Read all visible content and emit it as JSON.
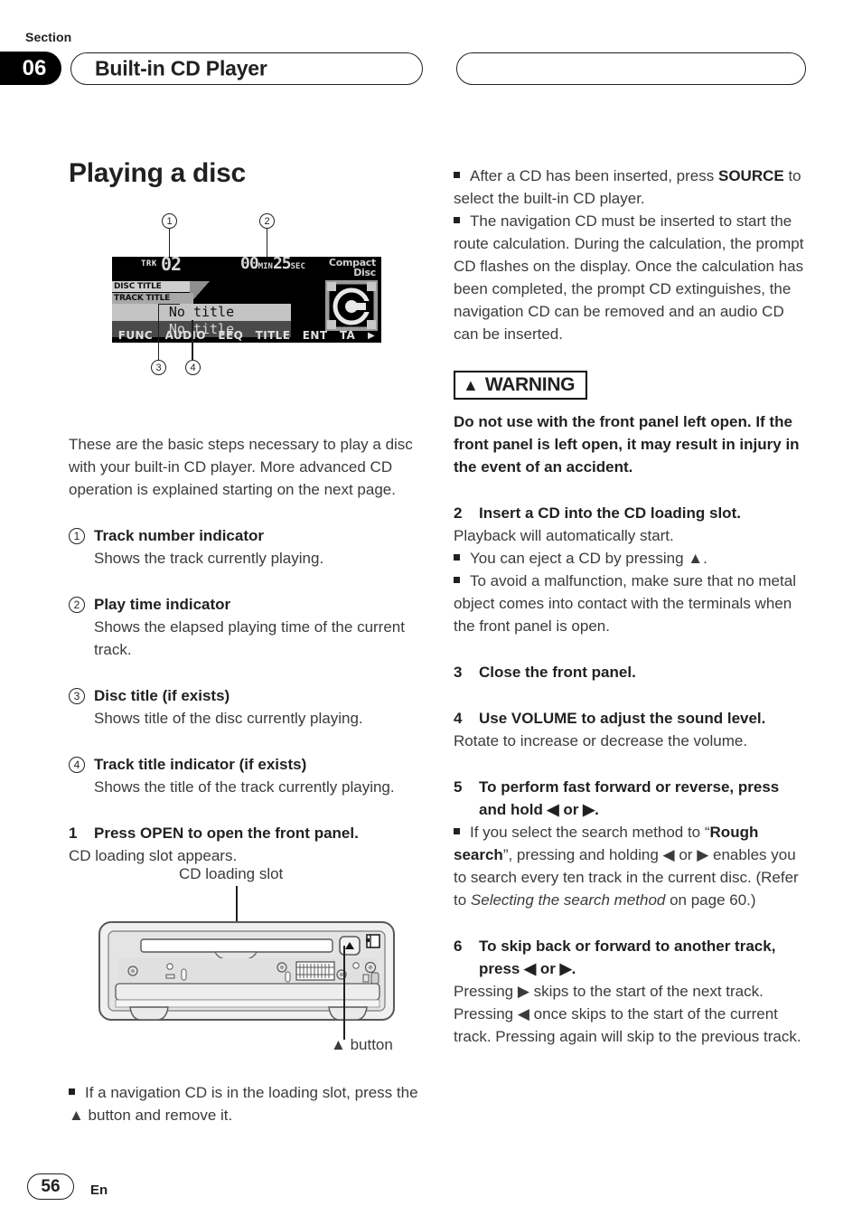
{
  "header": {
    "section_label": "Section",
    "section_number": "06",
    "title": "Built-in CD Player"
  },
  "left": {
    "page_title": "Playing a disc",
    "intro": "These are the basic steps necessary to play a disc with your built-in CD player. More advanced CD operation is explained starting on the next page.",
    "items": [
      {
        "num": "1",
        "title": "Track number indicator",
        "desc": "Shows the track currently playing."
      },
      {
        "num": "2",
        "title": "Play time indicator",
        "desc": "Shows the elapsed playing time of the current track."
      },
      {
        "num": "3",
        "title": "Disc title (if exists)",
        "desc": "Shows title of the disc currently playing."
      },
      {
        "num": "4",
        "title": "Track title indicator (if exists)",
        "desc": "Shows the title of the track currently playing."
      }
    ],
    "step1": {
      "num": "1",
      "title": "Press OPEN to open the front panel.",
      "body": "CD loading slot appears."
    },
    "figure": {
      "slot_label": "CD loading slot",
      "eject_label": "button",
      "eject_icon": "eject-icon"
    },
    "note": {
      "line1": "If a navigation CD is in the loading slot, press the ",
      "eject_icon": "▲",
      "line2": " button and remove it."
    }
  },
  "lcd": {
    "trk_label": "TRK",
    "track_number": "02",
    "time_min": "00",
    "min_label": "MIN",
    "time_sec": "25",
    "sec_label": "SEC",
    "logo_line1": "Compact",
    "logo_line2": "Disc",
    "disc_title_tag": "DISC TITLE",
    "track_title_tag": "TRACK TITLE",
    "disc_title_value": "No title",
    "track_title_value": "No title",
    "buttons": [
      "FUNC",
      "AUDIO",
      "EEQ",
      "TITLE",
      "ENT",
      "TA"
    ],
    "more_arrow": "▶",
    "callouts": [
      "1",
      "2",
      "3",
      "4"
    ]
  },
  "right": {
    "notes_top": [
      {
        "pre": "After a CD has been inserted, press ",
        "bold": "SOURCE",
        "post": " to select the built-in CD player."
      },
      {
        "pre": "The navigation CD must be inserted to start the route calculation. During the calculation, the prompt CD flashes on the display. Once the calculation has been completed, the prompt CD extinguishes, the navigation CD can be removed and an audio CD can be inserted.",
        "bold": "",
        "post": ""
      }
    ],
    "warning": {
      "label": "WARNING",
      "triangle": "⚠",
      "body": "Do not use with the front panel left open. If the front panel is left open, it may result in injury in the event of an accident."
    },
    "step2": {
      "num": "2",
      "title": "Insert a CD into the CD loading slot.",
      "body": "Playback will automatically start.",
      "notes": [
        "You can eject a CD by pressing ▲.",
        "To avoid a malfunction, make sure that no metal object comes into contact with the terminals when the front panel is open."
      ]
    },
    "step3": {
      "num": "3",
      "title": "Close the front panel."
    },
    "step4": {
      "num": "4",
      "title": "Use VOLUME to adjust the sound level.",
      "body": "Rotate to increase or decrease the volume."
    },
    "step5": {
      "num": "5",
      "title": "To perform fast forward or reverse, press and hold ◀ or ▶.",
      "note_a": "If you select the search method to “",
      "note_bold": "Rough search",
      "note_b": "”, pressing and holding ◀ or ▶ enables you to search every ten track in the current disc. (Refer to ",
      "note_italic": "Selecting the search method",
      "note_c": " on page 60.)"
    },
    "step6": {
      "num": "6",
      "title": "To skip back or forward to another track, press ◀ or ▶.",
      "body": "Pressing ▶ skips to the start of the next track. Pressing ◀ once skips to the start of the current track. Pressing again will skip to the previous track."
    }
  },
  "footer": {
    "page_number": "56",
    "language": "En"
  }
}
